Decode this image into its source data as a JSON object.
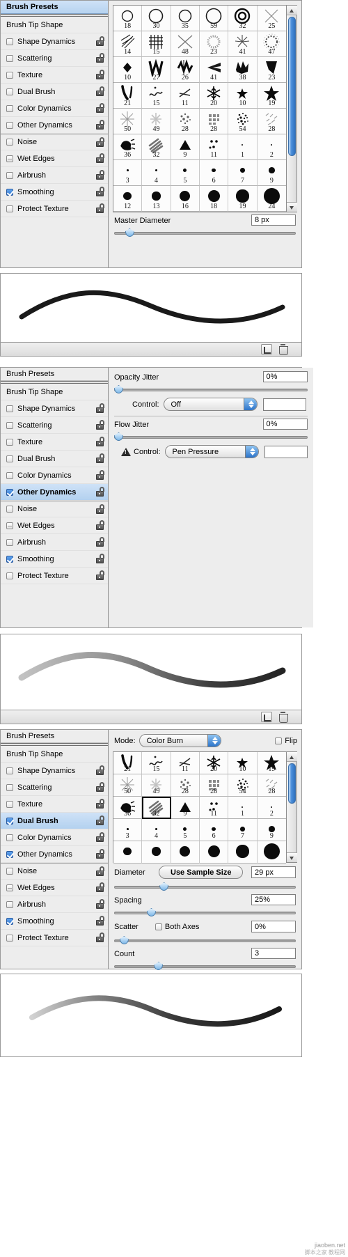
{
  "app": {
    "presets_label": "Brush Presets",
    "tip_shape_label": "Brush Tip Shape"
  },
  "sidebar_items": [
    {
      "label": "Shape Dynamics",
      "checked": false,
      "locked": true
    },
    {
      "label": "Scattering",
      "checked": false,
      "locked": true
    },
    {
      "label": "Texture",
      "checked": false,
      "locked": true
    },
    {
      "label": "Dual Brush",
      "checked": false,
      "locked": true
    },
    {
      "label": "Color Dynamics",
      "checked": false,
      "locked": true
    },
    {
      "label": "Other Dynamics",
      "checked": false,
      "locked": true
    },
    {
      "label": "Noise",
      "checked": false,
      "locked": true
    },
    {
      "label": "Wet Edges",
      "checked": false,
      "locked": true
    },
    {
      "label": "Airbrush",
      "checked": false,
      "locked": true
    },
    {
      "label": "Smoothing",
      "checked": true,
      "locked": true
    },
    {
      "label": "Protect Texture",
      "checked": false,
      "locked": true
    }
  ],
  "panel1": {
    "selected_item": "",
    "sidebar_checked": [
      "Smoothing"
    ],
    "grid": [
      [
        {
          "n": "18",
          "g": "ring-thin-sm"
        },
        {
          "n": "30",
          "g": "ring-thin-md"
        },
        {
          "n": "35",
          "g": "ring-thin-md2"
        },
        {
          "n": "59",
          "g": "ring-thin-lg"
        },
        {
          "n": "32",
          "g": "ring-double"
        },
        {
          "n": "25",
          "g": "cross-x-soft"
        }
      ],
      [
        {
          "n": "14",
          "g": "hatch-slash"
        },
        {
          "n": "15",
          "g": "grid-hash"
        },
        {
          "n": "48",
          "g": "cross-x-large"
        },
        {
          "n": "23",
          "g": "ring-dotted"
        },
        {
          "n": "41",
          "g": "burst-spiral"
        },
        {
          "n": "47",
          "g": "ring-spiky"
        }
      ],
      [
        {
          "n": "10",
          "g": "diamond"
        },
        {
          "n": "27",
          "g": "zigzag-w"
        },
        {
          "n": "26",
          "g": "zigzag-m"
        },
        {
          "n": "41",
          "g": "wedge-left"
        },
        {
          "n": "38",
          "g": "splat-crown"
        },
        {
          "n": "23",
          "g": "wedge-dark"
        }
      ],
      [
        {
          "n": "21",
          "g": "stroke-pair"
        },
        {
          "n": "15",
          "g": "squiggle"
        },
        {
          "n": "11",
          "g": "scissor"
        },
        {
          "n": "20",
          "g": "snowflake"
        },
        {
          "n": "10",
          "g": "star-small"
        },
        {
          "n": "19",
          "g": "star-large"
        }
      ],
      [
        {
          "n": "50",
          "g": "sparkle-thin"
        },
        {
          "n": "49",
          "g": "sparkle-soft"
        },
        {
          "n": "28",
          "g": "speckle-cluster"
        },
        {
          "n": "28",
          "g": "blur-block"
        },
        {
          "n": "54",
          "g": "speckle-dense"
        },
        {
          "n": "28",
          "g": "dashes"
        }
      ],
      [
        {
          "n": "36",
          "g": "scribble-blob"
        },
        {
          "n": "32",
          "g": "streaks"
        },
        {
          "n": "9",
          "g": "triangle"
        },
        {
          "n": "11",
          "g": "dots-tri"
        },
        {
          "n": "1",
          "g": "dot-1"
        },
        {
          "n": "2",
          "g": "dot-2"
        }
      ],
      [
        {
          "n": "3",
          "g": "dot-3"
        },
        {
          "n": "4",
          "g": "dot-4"
        },
        {
          "n": "5",
          "g": "dot-5"
        },
        {
          "n": "6",
          "g": "dot-6"
        },
        {
          "n": "7",
          "g": "dot-7"
        },
        {
          "n": "9",
          "g": "dot-9"
        }
      ],
      [
        {
          "n": "12",
          "g": "dot-12"
        },
        {
          "n": "13",
          "g": "dot-13"
        },
        {
          "n": "16",
          "g": "dot-16"
        },
        {
          "n": "18",
          "g": "dot-18"
        },
        {
          "n": "19",
          "g": "dot-19"
        },
        {
          "n": "24",
          "g": "dot-24"
        }
      ]
    ],
    "master_diameter_label": "Master Diameter",
    "master_diameter_value": "8 px",
    "master_diameter_percent": 6
  },
  "panel2": {
    "sidebar_checked": [
      "Other Dynamics",
      "Smoothing"
    ],
    "active_item": "Other Dynamics",
    "opacity_jitter_label": "Opacity Jitter",
    "opacity_jitter_value": "0%",
    "opacity_jitter_percent": 0,
    "opacity_control_label": "Control:",
    "opacity_control_value": "Off",
    "flow_jitter_label": "Flow Jitter",
    "flow_jitter_value": "0%",
    "flow_jitter_percent": 0,
    "flow_control_label": "Control:",
    "flow_control_value": "Pen Pressure"
  },
  "panel3": {
    "sidebar_checked": [
      "Dual Brush",
      "Other Dynamics",
      "Smoothing"
    ],
    "active_item": "Dual Brush",
    "mode_label": "Mode:",
    "mode_value": "Color Burn",
    "flip_label": "Flip",
    "flip_checked": false,
    "grid": [
      [
        {
          "n": "21",
          "g": "stroke-pair"
        },
        {
          "n": "15",
          "g": "squiggle"
        },
        {
          "n": "11",
          "g": "scissor"
        },
        {
          "n": "20",
          "g": "snowflake"
        },
        {
          "n": "10",
          "g": "star-small"
        },
        {
          "n": "19",
          "g": "star-large"
        }
      ],
      [
        {
          "n": "50",
          "g": "sparkle-thin"
        },
        {
          "n": "49",
          "g": "sparkle-soft"
        },
        {
          "n": "28",
          "g": "speckle-cluster"
        },
        {
          "n": "28",
          "g": "blur-block"
        },
        {
          "n": "54",
          "g": "speckle-dense"
        },
        {
          "n": "28",
          "g": "dashes"
        }
      ],
      [
        {
          "n": "36",
          "g": "scribble-blob"
        },
        {
          "n": "32",
          "g": "streaks",
          "selected": true
        },
        {
          "n": "9",
          "g": "triangle"
        },
        {
          "n": "11",
          "g": "dots-tri"
        },
        {
          "n": "1",
          "g": "dot-1"
        },
        {
          "n": "2",
          "g": "dot-2"
        }
      ],
      [
        {
          "n": "3",
          "g": "dot-3"
        },
        {
          "n": "4",
          "g": "dot-4"
        },
        {
          "n": "5",
          "g": "dot-5"
        },
        {
          "n": "6",
          "g": "dot-6"
        },
        {
          "n": "7",
          "g": "dot-7"
        },
        {
          "n": "9",
          "g": "dot-9"
        }
      ],
      [
        {
          "n": "",
          "g": "dot-12"
        },
        {
          "n": "",
          "g": "dot-13"
        },
        {
          "n": "",
          "g": "dot-16"
        },
        {
          "n": "",
          "g": "dot-18"
        },
        {
          "n": "",
          "g": "dot-19"
        },
        {
          "n": "",
          "g": "dot-24"
        }
      ]
    ],
    "diameter_label": "Diameter",
    "use_sample_size_label": "Use Sample Size",
    "diameter_value": "29 px",
    "diameter_percent": 25,
    "spacing_label": "Spacing",
    "spacing_value": "25%",
    "spacing_percent": 18,
    "scatter_label": "Scatter",
    "both_axes_label": "Both Axes",
    "both_axes_checked": false,
    "scatter_value": "0%",
    "scatter_percent": 3,
    "count_label": "Count",
    "count_value": "3",
    "count_percent": 22
  },
  "icons": {
    "new_brush": "new-document-icon",
    "delete_brush": "trash-icon",
    "warning": "warning-triangle-icon",
    "lock": "lock-icon",
    "scroll_up": "chevron-up-icon",
    "scroll_down": "chevron-down-icon"
  },
  "watermark": {
    "line1": "脚本之家  教程网",
    "line2": "jiaoben.net"
  },
  "colors": {
    "accent": "#2f74cd",
    "selection": "#b6d3f0",
    "panel_bg": "#ededed",
    "border": "#8d8d8d"
  }
}
